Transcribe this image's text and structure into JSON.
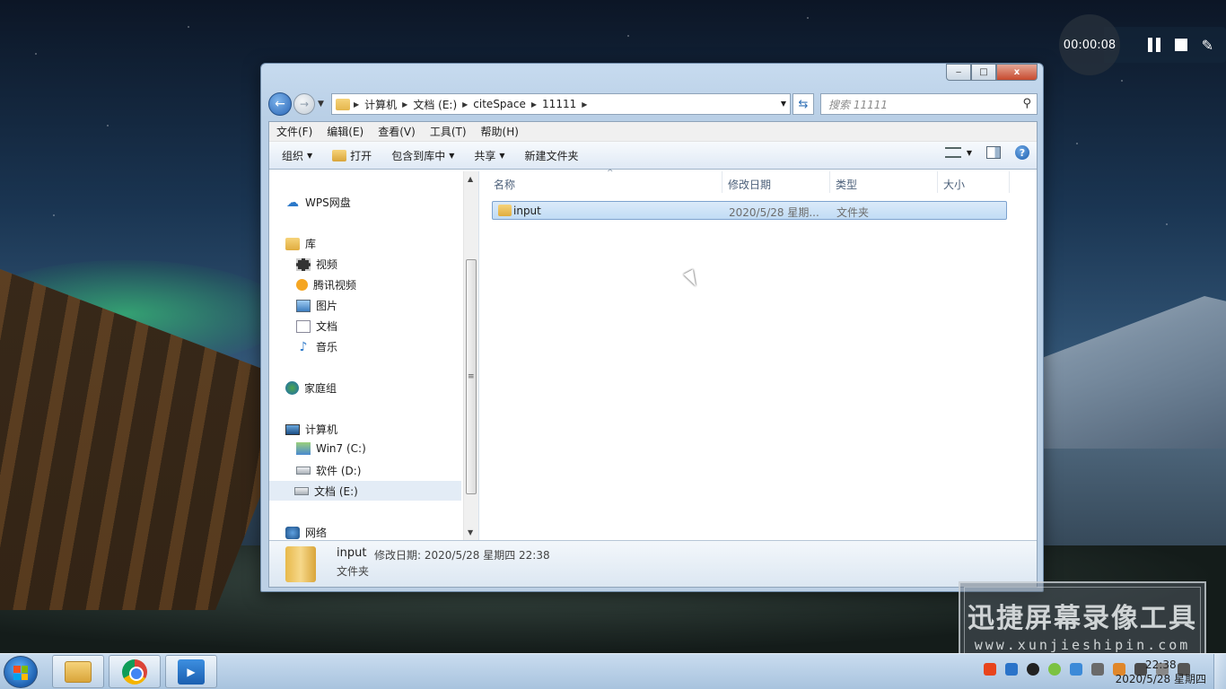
{
  "recorder": {
    "timer": "00:00:08",
    "pause_icon": "pause-icon",
    "stop_icon": "stop-icon",
    "pen_icon": "pen-icon"
  },
  "window": {
    "caption_buttons": {
      "minimize": "‒",
      "maximize": "□",
      "close": "x"
    },
    "address": {
      "crumbs": [
        "计算机",
        "文档 (E:)",
        "citeSpace",
        "11111"
      ]
    },
    "search_placeholder": "搜索 11111",
    "menu": [
      "文件(F)",
      "编辑(E)",
      "查看(V)",
      "工具(T)",
      "帮助(H)"
    ],
    "toolbar": {
      "organize": "组织",
      "open": "打开",
      "include": "包含到库中",
      "share": "共享",
      "new_folder": "新建文件夹"
    },
    "nav": {
      "wps": "WPS网盘",
      "library": "库",
      "video": "视频",
      "tencent_video": "腾讯视频",
      "pictures": "图片",
      "documents": "文档",
      "music": "音乐",
      "homegroup": "家庭组",
      "computer": "计算机",
      "drive_c": "Win7 (C:)",
      "drive_d": "软件 (D:)",
      "drive_e": "文档 (E:)",
      "network": "网络"
    },
    "columns": [
      "名称",
      "修改日期",
      "类型",
      "大小"
    ],
    "files": [
      {
        "name": "input",
        "modified": "2020/5/28 星期...",
        "type": "文件夹",
        "size": ""
      }
    ],
    "details": {
      "name": "input",
      "modified": "修改日期: 2020/5/28 星期四 22:38",
      "type": "文件夹"
    }
  },
  "watermark": {
    "title": "迅捷屏幕录像工具",
    "url": "www.xunjieshipin.com"
  },
  "taskbar": {
    "apps": [
      "windows-explorer-icon",
      "chrome-icon",
      "screen-recorder-icon"
    ],
    "clock_time": "22:38",
    "clock_date": "2020/5/28 星期四"
  }
}
